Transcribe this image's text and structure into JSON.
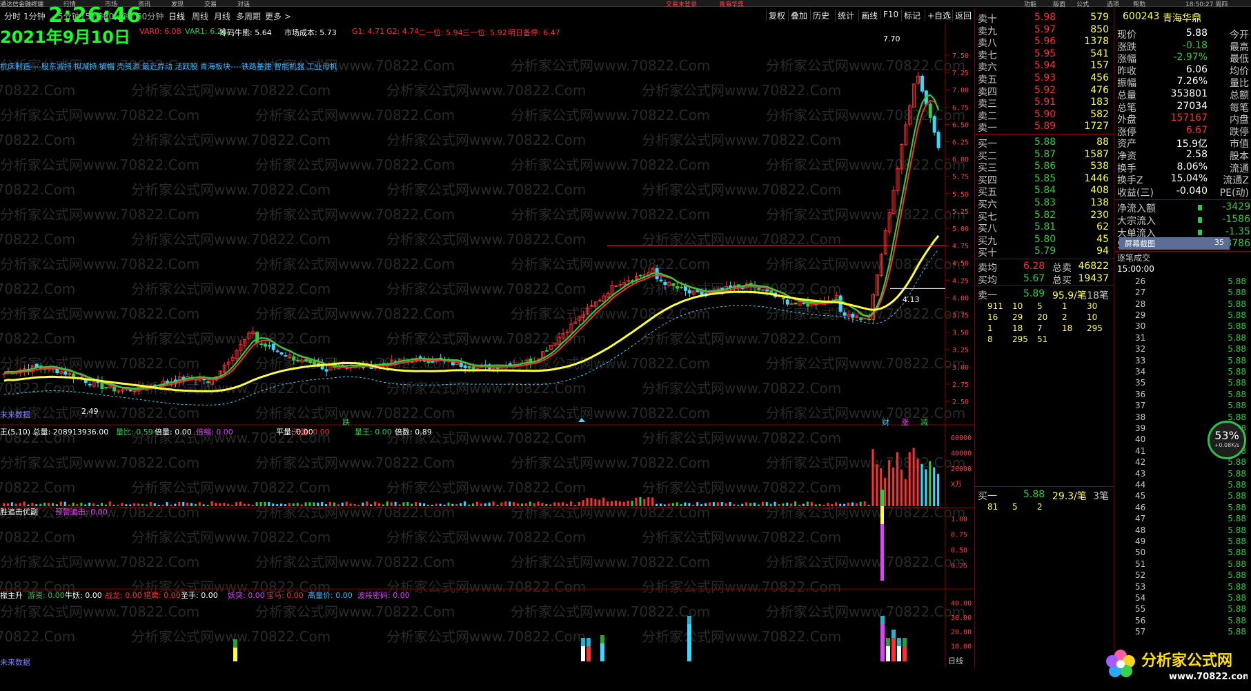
{
  "topbar": {
    "items": [
      "通达信金融终端",
      "行情",
      "市场",
      "资讯",
      "发现",
      "交易",
      "对话"
    ],
    "center": [
      "交易未登录",
      "青海华鼎"
    ],
    "right": [
      "功能",
      "版面",
      "公式",
      "选项",
      "帮助"
    ],
    "clock": "18:50:27 周四"
  },
  "overlay": {
    "time": "2:26:46",
    "date": "2021年9月10日"
  },
  "toolbar": {
    "periods": [
      "分时",
      "1分钟",
      "5分钟",
      "15分钟",
      "30分钟",
      "60分钟",
      "日线",
      "周线",
      "月线",
      "多周期",
      "更多 >"
    ],
    "active": "日线",
    "buttons": [
      "复权",
      "叠加",
      "历史",
      "统计",
      "画线",
      "F10",
      "标记",
      "+自选",
      "返回"
    ]
  },
  "indicator_main": [
    {
      "text": "VAR0: 6.08",
      "color": "#ff3030"
    },
    {
      "text": "VAR1: 6.21",
      "color": "#2ecc40"
    },
    {
      "text": "筹码牛熊: 5.64",
      "color": "#ffffff"
    },
    {
      "text": "市场成本: 5.73",
      "color": "#ffffff"
    },
    {
      "text": "G1: 4.71",
      "color": "#ff3030"
    },
    {
      "text": "G2: 4.74",
      "color": "#ff3030"
    },
    {
      "text": "二一位: 5.94",
      "color": "#ff3030"
    },
    {
      "text": "三一位: 5.92",
      "color": "#ff3030"
    },
    {
      "text": "明日备停: 6.47",
      "color": "#ff3030"
    }
  ],
  "concepts": "机床制造----股东减持 拟减持 摘帽 壳资源 最近异动 活跃股 青海板块----铁路基建 智能机器 工业母机",
  "labels": {
    "future_data": "未来数据",
    "high_label": "7.70",
    "low_label": "2.49",
    "mid_label": "4.13",
    "marker_die": "跌",
    "marker_cai": "财",
    "marker_zhang": "涨",
    "marker_jian": "减",
    "day_label": "日线"
  },
  "volume_indicator": [
    {
      "text": "王(5,10) 总量: 208913936.00",
      "color": "#ffffff"
    },
    {
      "text": "量比: 0.59",
      "color": "#2ecc40"
    },
    {
      "text": "倍量: 0.00",
      "color": "#ffffff"
    },
    {
      "text": "倍缩: 0.00",
      "color": "#e040fb"
    },
    {
      "text": "天量: 0.00",
      "color": "#ff3030"
    },
    {
      "text": "平量: 0.00",
      "color": "#ffffff"
    },
    {
      "text": "量王: 0.00",
      "color": "#2ecc40"
    },
    {
      "text": "倍数: 0.89",
      "color": "#ffffff"
    }
  ],
  "sub1_indicator": [
    {
      "text": "胜追击优副",
      "color": "#ffffff"
    },
    {
      "text": "预警追击: 0.00",
      "color": "#e040fb"
    }
  ],
  "sub2_indicator": [
    {
      "text": "振主升",
      "color": "#ffffff"
    },
    {
      "text": "游资: 0.00",
      "color": "#2ecc40"
    },
    {
      "text": "牛妖: 0.00",
      "color": "#ffffff"
    },
    {
      "text": "战龙: 0.00",
      "color": "#ff3030"
    },
    {
      "text": "猎鹰: 0.00",
      "color": "#ff3030"
    },
    {
      "text": "圣手: 0.00",
      "color": "#ffffff"
    },
    {
      "text": "妖突: 0.00",
      "color": "#e040fb"
    },
    {
      "text": "宝马: 0.00",
      "color": "#ff3030"
    },
    {
      "text": "高量价: 0.00",
      "color": "#38b8ff"
    },
    {
      "text": "波段密码: 0.00",
      "color": "#e040fb"
    }
  ],
  "price_axis": [
    "7.50",
    "7.25",
    "7.00",
    "6.75",
    "6.50",
    "6.25",
    "6.00",
    "5.75",
    "5.50",
    "5.25",
    "5.00",
    "4.75",
    "4.50",
    "4.25",
    "4.00",
    "3.75",
    "3.50",
    "3.25",
    "3.00",
    "2.75",
    "2.50"
  ],
  "vol_axis": [
    "60000",
    "40000",
    "20000",
    "X万"
  ],
  "sub1_axis": [
    "1.00",
    "0.75",
    "0.50",
    "0.25"
  ],
  "sub2_axis": [
    "40.00",
    "30.00",
    "20.00",
    "10.00"
  ],
  "asks": [
    {
      "label": "卖十",
      "price": "5.98",
      "vol": "579"
    },
    {
      "label": "卖九",
      "price": "5.97",
      "vol": "850"
    },
    {
      "label": "卖八",
      "price": "5.96",
      "vol": "1378"
    },
    {
      "label": "卖七",
      "price": "5.95",
      "vol": "541"
    },
    {
      "label": "卖六",
      "price": "5.94",
      "vol": "157"
    },
    {
      "label": "卖五",
      "price": "5.93",
      "vol": "456"
    },
    {
      "label": "卖四",
      "price": "5.92",
      "vol": "476"
    },
    {
      "label": "卖三",
      "price": "5.91",
      "vol": "183"
    },
    {
      "label": "卖二",
      "price": "5.90",
      "vol": "582"
    },
    {
      "label": "卖一",
      "price": "5.89",
      "vol": "1727"
    }
  ],
  "bids": [
    {
      "label": "买一",
      "price": "5.88",
      "vol": "88"
    },
    {
      "label": "买二",
      "price": "5.87",
      "vol": "1587"
    },
    {
      "label": "买三",
      "price": "5.86",
      "vol": "538"
    },
    {
      "label": "买四",
      "price": "5.85",
      "vol": "1446"
    },
    {
      "label": "买五",
      "price": "5.84",
      "vol": "408"
    },
    {
      "label": "买六",
      "price": "5.83",
      "vol": "138"
    },
    {
      "label": "买七",
      "price": "5.82",
      "vol": "230"
    },
    {
      "label": "买八",
      "price": "5.81",
      "vol": "62"
    },
    {
      "label": "买九",
      "price": "5.80",
      "vol": "45"
    },
    {
      "label": "买十",
      "price": "5.79",
      "vol": "94"
    }
  ],
  "averages": [
    {
      "label": "卖均",
      "price": "6.28",
      "tlabel": "总卖",
      "total": "46822"
    },
    {
      "label": "买均",
      "price": "5.67",
      "tlabel": "总买",
      "total": "19437"
    }
  ],
  "queue_sell": {
    "label": "卖一",
    "price": "5.89",
    "avg": "95.9/笔",
    "count": "18笔",
    "rows": [
      [
        "911",
        "10",
        "5",
        "1",
        "30"
      ],
      [
        "16",
        "29",
        "20",
        "2",
        "10"
      ],
      [
        "1",
        "18",
        "7",
        "18",
        "295"
      ],
      [
        "8",
        "295",
        "51",
        "",
        ""
      ]
    ]
  },
  "queue_buy": {
    "label": "买一",
    "price": "5.88",
    "avg": "29.3/笔",
    "count": "3笔",
    "rows": [
      [
        "81",
        "5",
        "2",
        "",
        ""
      ]
    ]
  },
  "stock": {
    "code": "600243",
    "name": "青海华鼎"
  },
  "info_rows": [
    {
      "l": "现价",
      "v": "5.88",
      "r": "今开",
      "c": "#ffffff"
    },
    {
      "l": "涨跌",
      "v": "-0.18",
      "r": "最高",
      "c": "#2ecc40"
    },
    {
      "l": "涨幅",
      "v": "-2.97%",
      "r": "最低",
      "c": "#2ecc40"
    },
    {
      "l": "昨收",
      "v": "6.06",
      "r": "均价",
      "c": "#ffffff"
    },
    {
      "l": "振幅",
      "v": "7.26%",
      "r": "量比",
      "c": "#ffffff"
    },
    {
      "l": "总量",
      "v": "353801",
      "r": "总额",
      "c": "#ffffff"
    },
    {
      "l": "总笔",
      "v": "27034",
      "r": "每笔",
      "c": "#ffffff"
    },
    {
      "l": "外盘",
      "v": "157167",
      "r": "内盘",
      "c": "#ff3030"
    },
    {
      "l": "涨停",
      "v": "6.67",
      "r": "跌停",
      "c": "#ff3030"
    },
    {
      "l": "资产",
      "v": "15.9亿",
      "r": "市值",
      "c": "#ffffff"
    },
    {
      "l": "净资",
      "v": "2.58",
      "r": "股本",
      "c": "#ffffff"
    },
    {
      "l": "换手",
      "v": "8.06%",
      "r": "流通",
      "c": "#ffffff"
    },
    {
      "l": "换手Z",
      "v": "15.04%",
      "r": "流通Z",
      "c": "#ffffff"
    },
    {
      "l": "收益(三)",
      "v": "-0.040",
      "r": "PE(动)",
      "c": "#ffffff"
    }
  ],
  "flows": [
    {
      "l": "净流入额",
      "v": "-3429"
    },
    {
      "l": "大宗流入",
      "v": "-1586"
    },
    {
      "l": "大单流入",
      "v": "-1.35"
    },
    {
      "l": "5日大宗流入",
      "v": "-3786"
    }
  ],
  "screenshot_btn": "屏幕截图",
  "screenshot_num": "35",
  "ticks_title": "逐笔成交",
  "ticks_time": "15:00:00",
  "ticks": [
    {
      "v": "26",
      "p": "5.88"
    },
    {
      "v": "27",
      "p": "5.88"
    },
    {
      "v": "28",
      "p": "5.88"
    },
    {
      "v": "29",
      "p": "5.88"
    },
    {
      "v": "30",
      "p": "5.88"
    },
    {
      "v": "31",
      "p": "5.88"
    },
    {
      "v": "32",
      "p": "5.88"
    },
    {
      "v": "33",
      "p": "5.88"
    },
    {
      "v": "34",
      "p": "5.88"
    },
    {
      "v": "35",
      "p": "5.88"
    },
    {
      "v": "36",
      "p": "5.88"
    },
    {
      "v": "37",
      "p": "5.88"
    },
    {
      "v": "38",
      "p": "5.88"
    },
    {
      "v": "39",
      "p": "5.88"
    },
    {
      "v": "40",
      "p": "5.88"
    },
    {
      "v": "41",
      "p": "5.88"
    },
    {
      "v": "42",
      "p": "5.88"
    },
    {
      "v": "43",
      "p": "5.88"
    },
    {
      "v": "44",
      "p": "5.88"
    },
    {
      "v": "45",
      "p": "5.88"
    },
    {
      "v": "46",
      "p": "5.88"
    },
    {
      "v": "47",
      "p": "5.88"
    },
    {
      "v": "48",
      "p": "5.88"
    },
    {
      "v": "49",
      "p": "5.88"
    },
    {
      "v": "50",
      "p": "5.88"
    },
    {
      "v": "51",
      "p": "5.88"
    },
    {
      "v": "52",
      "p": "5.88"
    },
    {
      "v": "53",
      "p": "5.88"
    },
    {
      "v": "54",
      "p": "5.88"
    },
    {
      "v": "55",
      "p": "5.88"
    },
    {
      "v": "56",
      "p": "5.88"
    },
    {
      "v": "57",
      "p": "5.88"
    }
  ],
  "gauge": {
    "pct": "53%",
    "speed": "+0.08K/s"
  },
  "logo": {
    "text": "分析家公式网",
    "url": "www.70822.com"
  },
  "watermark": "分析家公式网www.70822.Com",
  "colors": {
    "up": "#ff3030",
    "down": "#2ecc40",
    "ma_yellow": "#ffff40",
    "cyan": "#38d8ff",
    "bg": "#000000"
  }
}
